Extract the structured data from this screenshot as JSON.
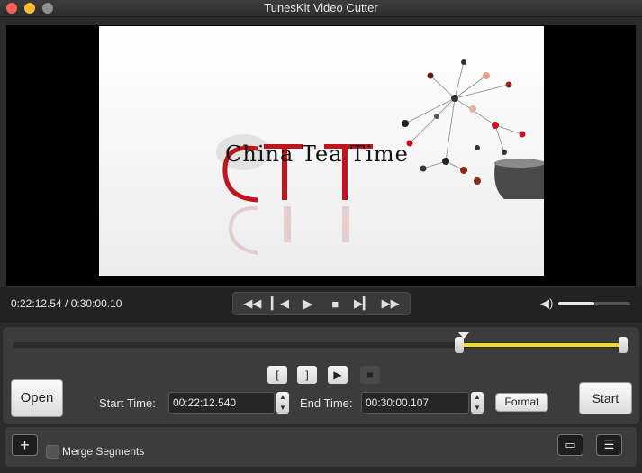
{
  "window": {
    "title": "TunesKit Video Cutter"
  },
  "video": {
    "overlay_text": "China Tea Time"
  },
  "player": {
    "timecode": "0:22:12.54 / 0:30:00.10",
    "volume_level": 0.5
  },
  "timeline": {
    "selection_start_fraction": 0.725,
    "selection_end_fraction": 0.99,
    "playhead_fraction": 0.725
  },
  "buttons": {
    "open": "Open",
    "start": "Start",
    "format": "Format"
  },
  "times": {
    "start_label": "Start Time:",
    "start_value": "00:22:12.540",
    "end_label": "End Time:",
    "end_value": "00:30:00.107"
  },
  "footer": {
    "merge_label": "Merge Segments"
  },
  "colors": {
    "selection": "#f3db22",
    "close": "#fe5f57",
    "minimize": "#febc2e",
    "zoom": "#8e8e8e"
  }
}
